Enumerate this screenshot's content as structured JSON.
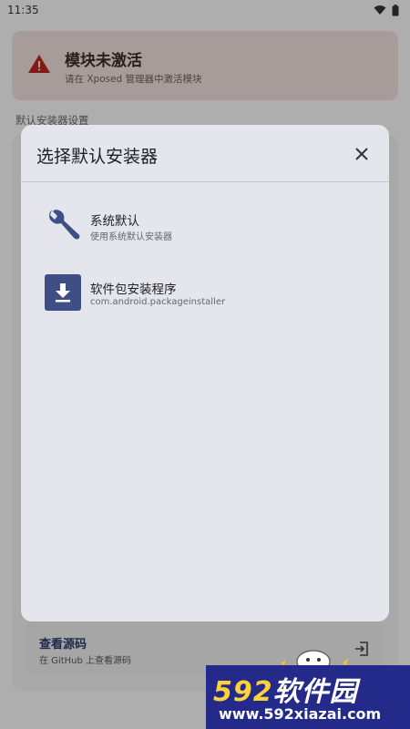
{
  "status": {
    "time": "11:35"
  },
  "warning": {
    "title": "模块未激活",
    "subtitle": "请在 Xposed 管理器中激活模块"
  },
  "background": {
    "section_label": "默认安装器设置",
    "source": {
      "title": "查看源码",
      "subtitle": "在 GitHub 上查看源码"
    }
  },
  "dialog": {
    "title": "选择默认安装器",
    "options": [
      {
        "title": "系统默认",
        "subtitle": "使用系统默认安装器",
        "icon": "wrench-icon"
      },
      {
        "title": "软件包安装程序",
        "subtitle": "com.android.packageinstaller",
        "icon": "download-icon"
      }
    ]
  },
  "watermark": {
    "brand_num": "592",
    "brand_text": "软件园",
    "url": "www.592xiazai.com"
  },
  "colors": {
    "accent": "#3e4f86",
    "warning_bg": "#e8d9d6",
    "dialog_bg": "#e5e5ee"
  }
}
